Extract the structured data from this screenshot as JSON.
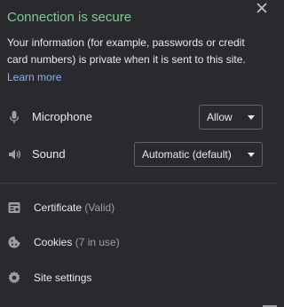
{
  "header": {
    "title": "Connection is secure",
    "description": "Your information (for example, passwords or credit card numbers) is private when it is sent to this site.",
    "learn_more": "Learn more",
    "close_icon": "close-icon"
  },
  "permissions": [
    {
      "label": "Microphone",
      "icon": "microphone-icon",
      "value": "Allow"
    },
    {
      "label": "Sound",
      "icon": "speaker-icon",
      "value": "Automatic (default)"
    }
  ],
  "links": [
    {
      "label": "Certificate",
      "sub": "(Valid)",
      "icon": "certificate-icon"
    },
    {
      "label": "Cookies",
      "sub": "(7 in use)",
      "icon": "cookie-icon"
    },
    {
      "label": "Site settings",
      "sub": "",
      "icon": "gear-icon"
    }
  ],
  "colors": {
    "background": "#292a2d",
    "secure_title": "#81c995",
    "link": "#8ab4f8",
    "text": "#e8eaed",
    "muted": "#9aa0a6",
    "divider": "#3c4043"
  }
}
